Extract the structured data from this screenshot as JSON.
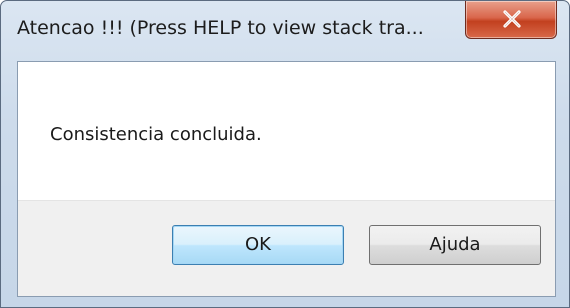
{
  "window": {
    "title": "Atencao !!! (Press HELP to view stack tra...",
    "close_icon": "close-x-icon"
  },
  "message": {
    "text": "Consistencia concluida."
  },
  "buttons": {
    "ok_label": "OK",
    "help_label": "Ajuda"
  },
  "colors": {
    "titlebar": "#cddbeb",
    "close_button": "#c2401f",
    "default_button_border": "#3c7fb1",
    "button_area": "#f0f0f0"
  }
}
